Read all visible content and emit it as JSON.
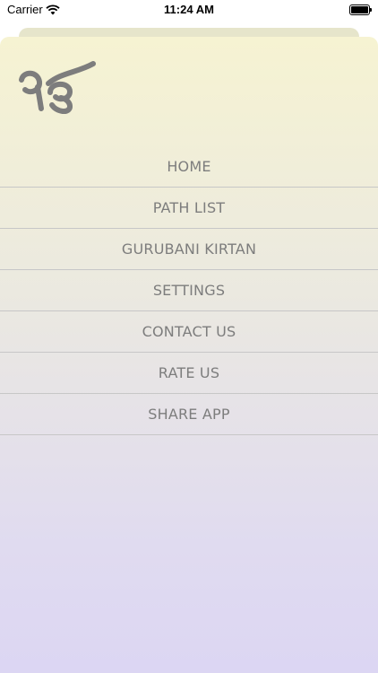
{
  "status_bar": {
    "carrier": "Carrier",
    "time": "11:24 AM"
  },
  "logo": {
    "icon": "ik-onkar-logo",
    "color": "#7d7d7d"
  },
  "menu": {
    "items": [
      {
        "label": "HOME"
      },
      {
        "label": "PATH LIST"
      },
      {
        "label": "GURUBANI KIRTAN"
      },
      {
        "label": "SETTINGS"
      },
      {
        "label": "CONTACT US"
      },
      {
        "label": "RATE US"
      },
      {
        "label": "SHARE APP"
      }
    ]
  },
  "colors": {
    "menu_text": "#7d7d7d",
    "divider": "#c7c7c7",
    "gradient_top": "#f6f3d2",
    "gradient_bottom": "#dcd6f3"
  }
}
